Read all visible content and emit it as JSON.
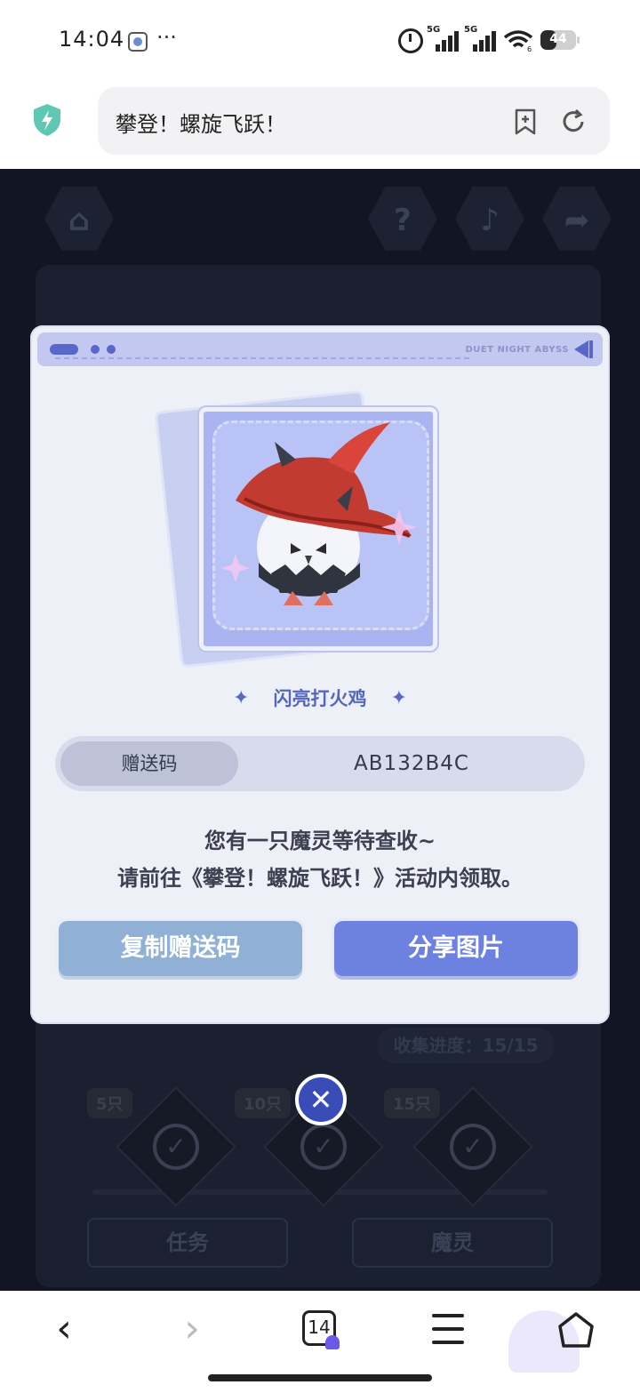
{
  "status_bar": {
    "time": "14:04",
    "more": "···",
    "signal1_label": "5G",
    "signal2_label": "5G",
    "wifi_label": "6",
    "battery": "44",
    "battery_level": 0.44
  },
  "browser": {
    "page_title": "攀登！螺旋飞跃！",
    "tab_count": "14"
  },
  "game_bg": {
    "progress_text": "收集进度：15/15",
    "milestones": [
      "5只",
      "10只",
      "15只"
    ],
    "tabs": [
      "任务",
      "魔灵"
    ]
  },
  "modal": {
    "brand": "DUET NIGHT ABYSS",
    "pet_name": "闪亮打火鸡",
    "code_label": "赠送码",
    "code_value": "AB132B4C",
    "message_line1": "您有一只魔灵等待查收~",
    "message_line2": "请前往《攀登！螺旋飞跃！》活动内领取。",
    "copy_button": "复制赠送码",
    "share_button": "分享图片",
    "sparkle": "✦"
  },
  "icons": {
    "close": "✕",
    "back": "‹",
    "forward": "›",
    "check": "✓",
    "home_hex": "⌂",
    "help_hex": "?",
    "music_hex": "♪",
    "share_hex": "➦"
  },
  "colors": {
    "accent": "#6d81e0",
    "copy_button": "#90b0d6",
    "header_bar": "#c2c8ef"
  }
}
